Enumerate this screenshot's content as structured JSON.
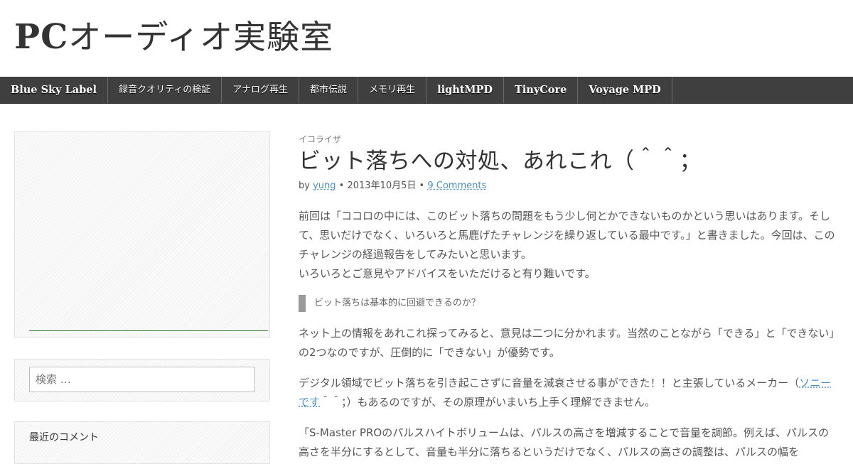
{
  "site": {
    "title_latin": "PC",
    "title_jp": "オーディオ実験室"
  },
  "nav": [
    {
      "label": "Blue Sky Label",
      "style": "en"
    },
    {
      "label": "録音クオリティの検証",
      "style": "ja"
    },
    {
      "label": "アナログ再生",
      "style": "ja"
    },
    {
      "label": "都市伝説",
      "style": "ja"
    },
    {
      "label": "メモリ再生",
      "style": "ja"
    },
    {
      "label": "lightMPD",
      "style": "en"
    },
    {
      "label": "TinyCore",
      "style": "en"
    },
    {
      "label": "Voyage MPD",
      "style": "en"
    }
  ],
  "sidebar": {
    "search_placeholder": "検索 …",
    "recent_comments_title": "最近のコメント"
  },
  "post": {
    "category": "イコライザ",
    "title": "ビット落ちへの対処、あれこれ（＾＾；",
    "meta_by": "by",
    "author": "yung",
    "date": "2013年10月5日",
    "comments": "9 Comments",
    "p1": "前回は「ココロの中には、このビット落ちの問題をもう少し何とかできないものかという思いはあります。そして、思いだけでなく、いろいろと馬鹿げたチャレンジを繰り返している最中です。」と書きました。今回は、このチャレンジの経過報告をしてみたいと思います。",
    "p1b": "いろいろとご意見やアドバイスをいただけると有り難いです。",
    "quote": "ビット落ちは基本的に回避できるのか？",
    "p2": "ネット上の情報をあれこれ探ってみると、意見は二つに分かれます。当然のことながら「できる」と「できない」の2つなのですが、圧倒的に「できない」が優勢です。",
    "p3_before": "デジタル領域でビット落ちを引き起こさずに音量を減衰させる事ができた！！と主張しているメーカー（",
    "p3_link": "ソニーです",
    "p3_after": "＾＾；）もあるのですが、その原理がいまいち上手く理解できません。",
    "p4": "「S-Master PROのパルスハイトボリュームは、パルスの高さを増減することで音量を調節。例えば、パルスの高さを半分にするとして、音量も半分に落ちるというだけでなく、パルスの高さの調整は、パルスの幅を"
  }
}
